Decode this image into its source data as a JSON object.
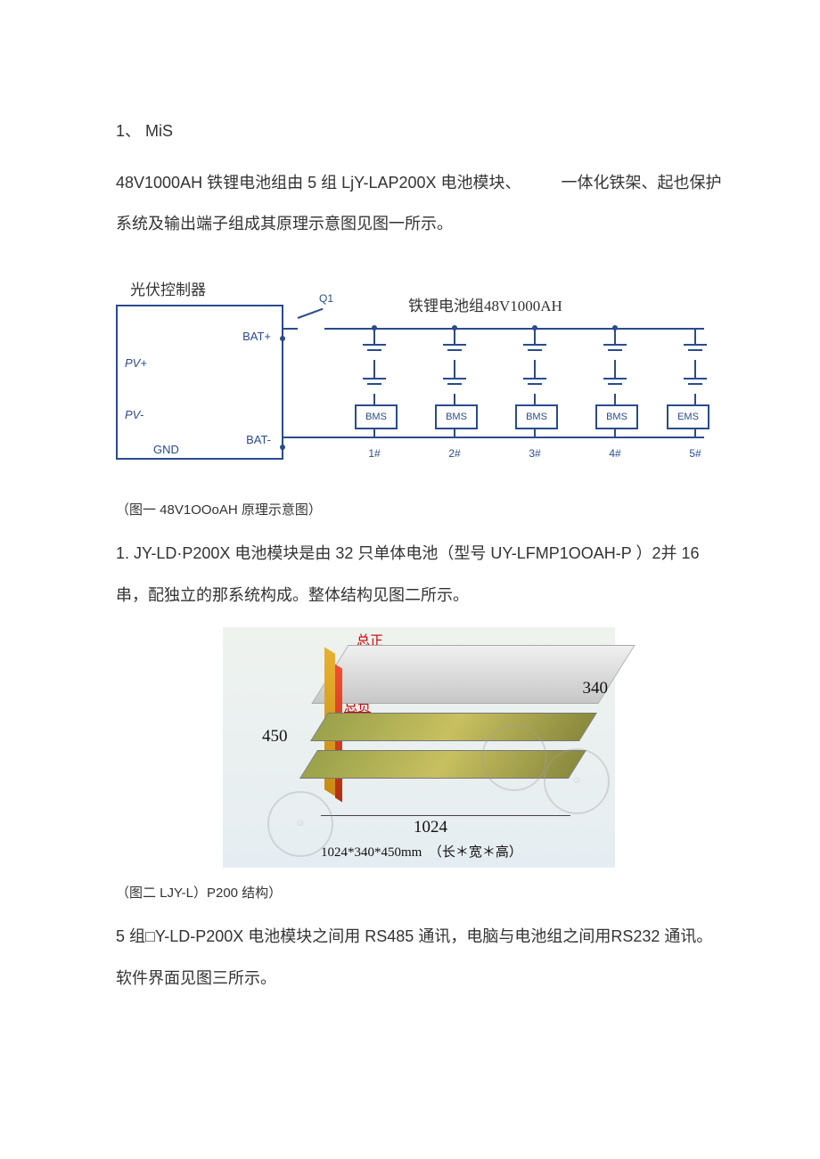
{
  "section": {
    "number": "1、",
    "heading": "MiS"
  },
  "para1": "48V1000AH 铁锂电池组由 5 组 LjY-LAP200X 电池模块、　　　一体化铁架、起也保护系统及输出端子组成其原理示意图见图一所示。",
  "fig1": {
    "outer_label": "光伏控制器",
    "title": "铁锂电池组48V1000AH",
    "switch_label": "Q1",
    "controller": {
      "bat_plus": "BAT+",
      "pv_plus": "PV+",
      "pv_minus": "PV-",
      "bat_minus": "BAT-",
      "gnd": "GND"
    },
    "columns": [
      {
        "box": "BMS",
        "idx": "1#"
      },
      {
        "box": "BMS",
        "idx": "2#"
      },
      {
        "box": "BMS",
        "idx": "3#"
      },
      {
        "box": "BMS",
        "idx": "4#"
      },
      {
        "box": "EMS",
        "idx": "5#"
      }
    ],
    "caption": "（图一 48V1OOoAH 原理示意图）"
  },
  "para2": "1. JY-LD·P200X 电池模块是由 32 只单体电池（型号 UY-LFMP1OOAH-P ）2并 16 串，配独立的那系统构成。整体结构见图二所示。",
  "fig2": {
    "label_pos": "总正",
    "label_neg": "总负",
    "dim_340": "340",
    "dim_450": "450",
    "dim_1024": "1024",
    "subcaption": "1024*340*450mm　（长＊宽＊高）",
    "caption": "（图二 LJY-L）P200 结构）"
  },
  "para3": "5 组□Y-LD-P200X 电池模块之间用 RS485 通讯，电脑与电池组之间用RS232 通讯。软件界面见图三所示。"
}
